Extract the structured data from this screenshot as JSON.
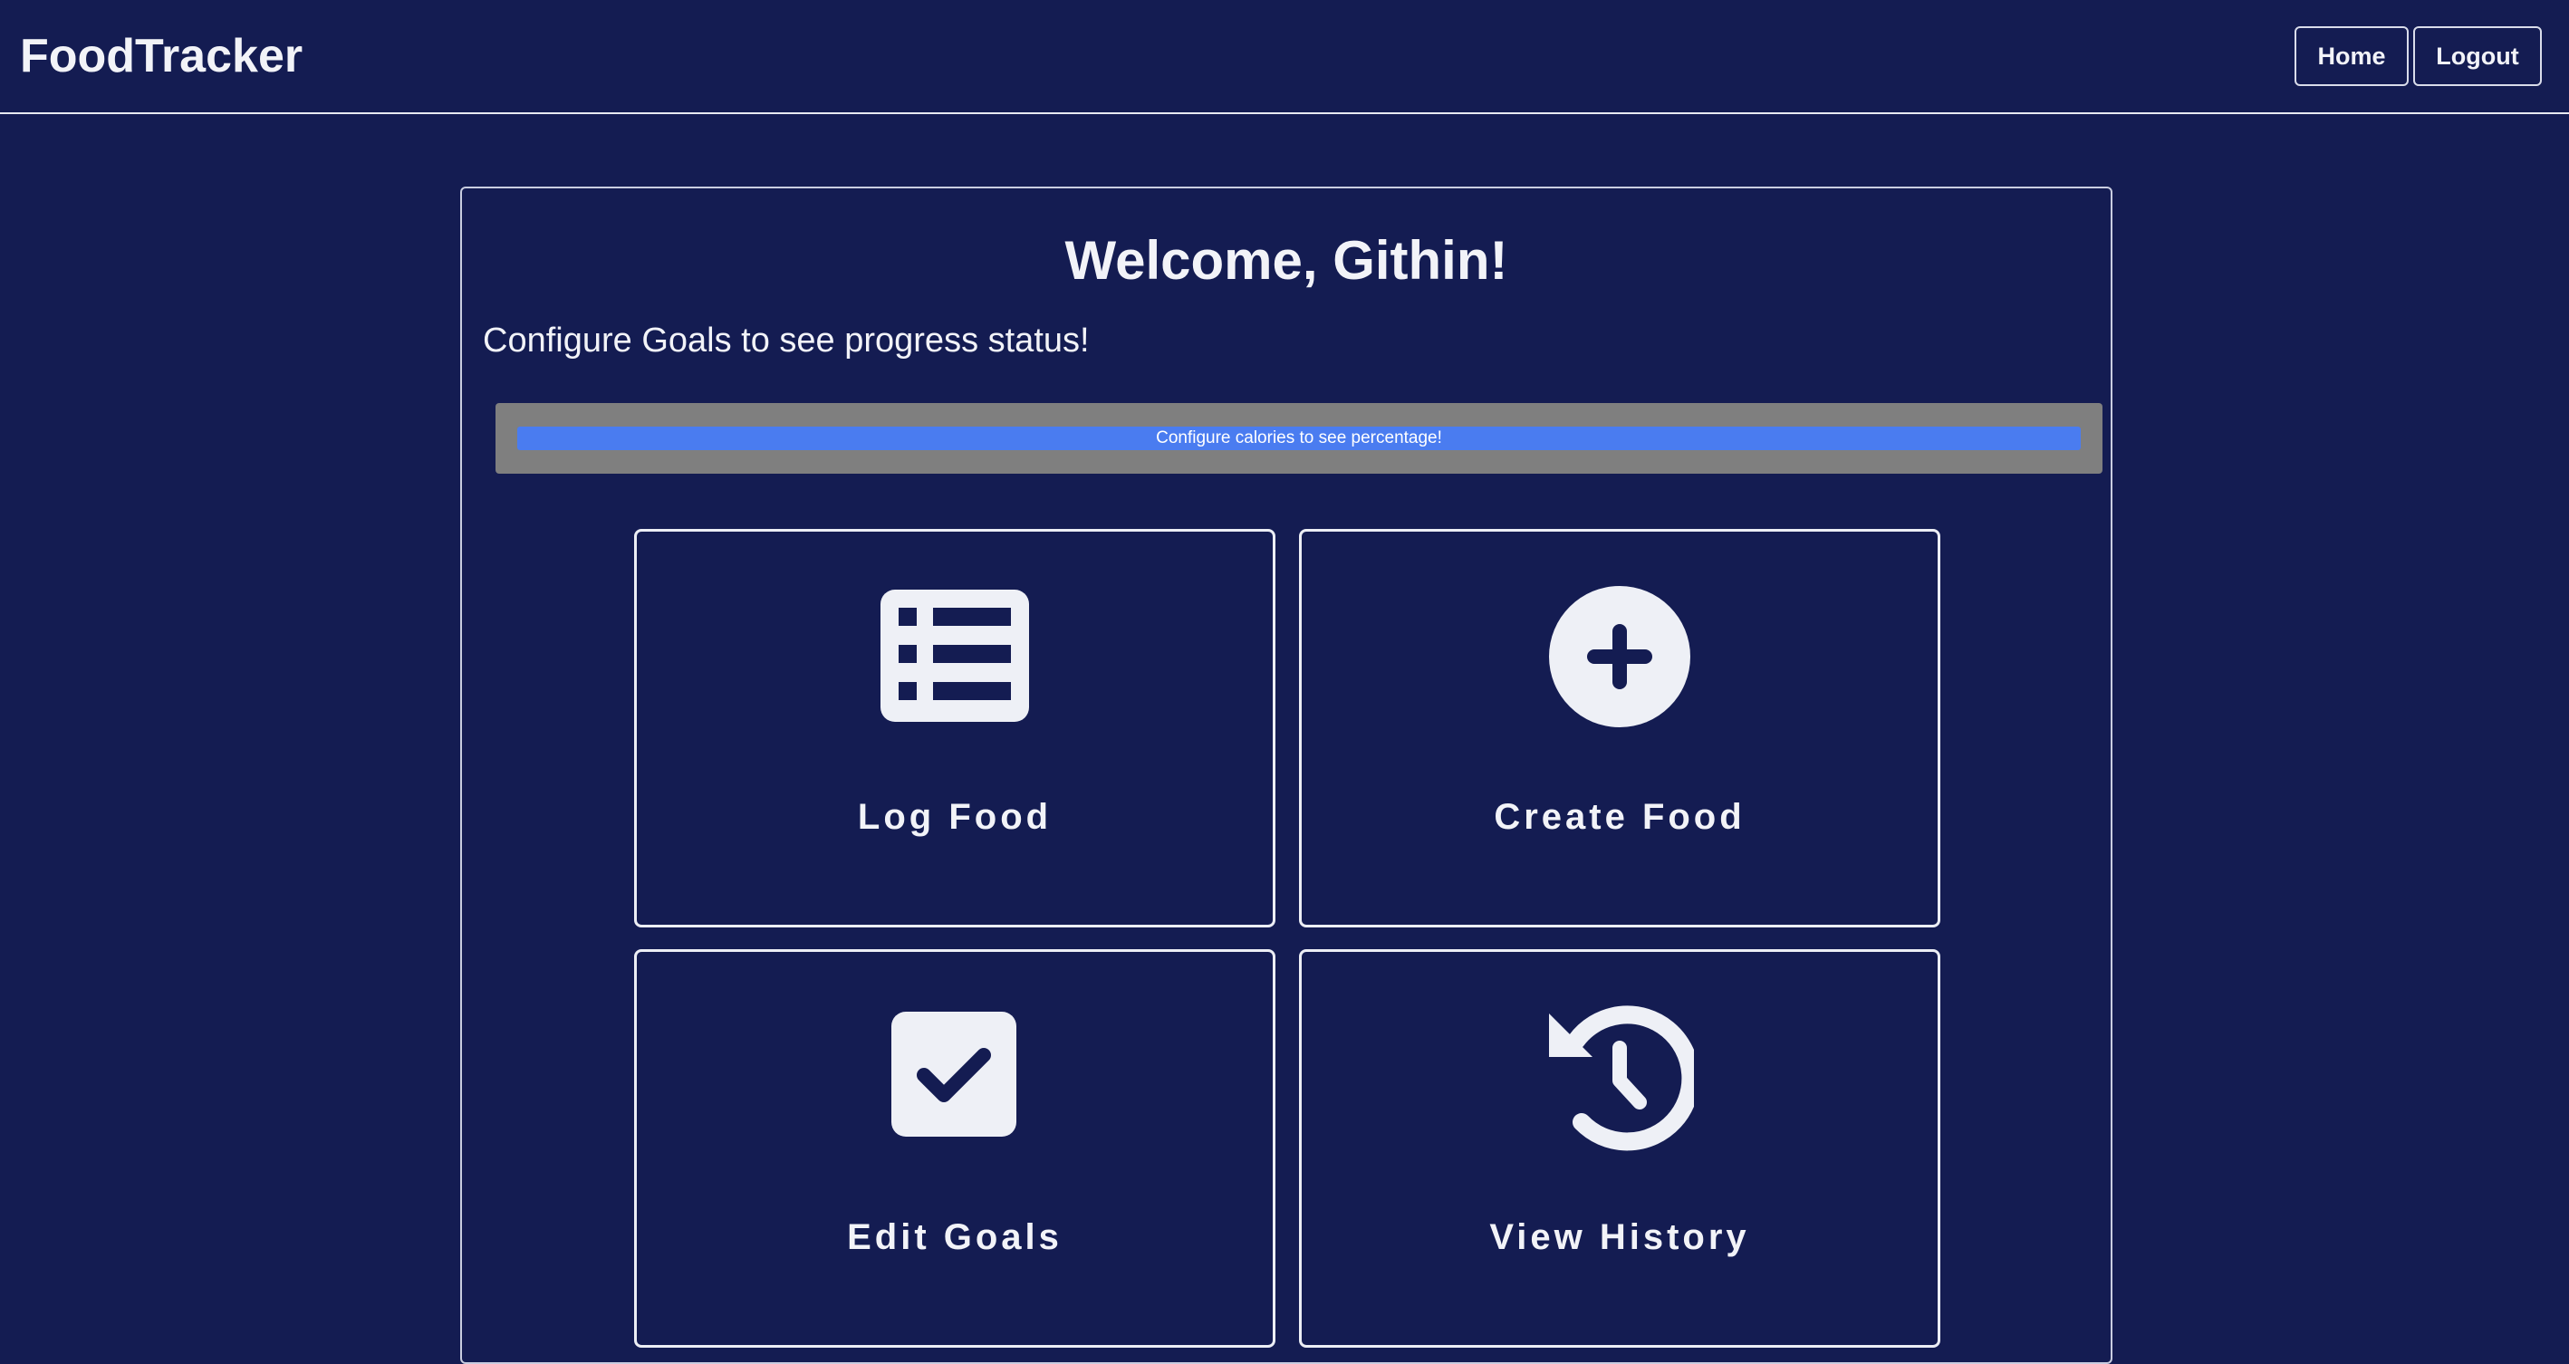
{
  "header": {
    "brand": "FoodTracker",
    "home_label": "Home",
    "logout_label": "Logout"
  },
  "main": {
    "welcome": "Welcome, Githin!",
    "subtitle": "Configure Goals to see progress status!",
    "progress": {
      "label": "Configure calories to see percentage!",
      "fill_fraction": 1.0,
      "track_color": "#7f7f7f",
      "fill_color": "#4a7cf0"
    },
    "tiles": [
      {
        "label": "Log Food",
        "icon": "list-icon"
      },
      {
        "label": "Create Food",
        "icon": "plus-circle-icon"
      },
      {
        "label": "Edit Goals",
        "icon": "checkbox-icon"
      },
      {
        "label": "View History",
        "icon": "history-icon"
      }
    ]
  },
  "colors": {
    "background": "#141c52",
    "text": "#f2f3f8",
    "border": "#eceef5"
  }
}
